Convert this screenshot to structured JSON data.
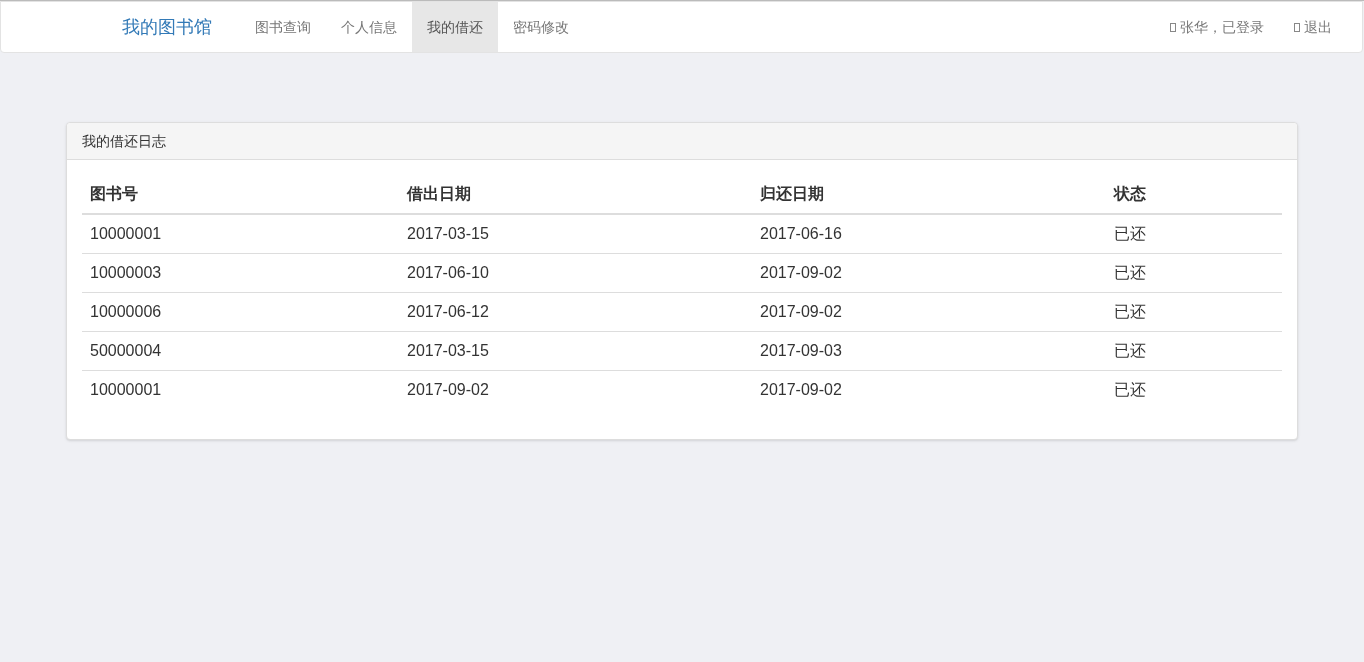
{
  "navbar": {
    "brand": "我的图书馆",
    "nav_items": [
      {
        "label": "图书查询",
        "selected": false
      },
      {
        "label": "个人信息",
        "selected": false
      },
      {
        "label": "我的借还",
        "selected": true
      },
      {
        "label": "密码修改",
        "selected": false
      }
    ],
    "right_items": [
      "张华，已登录",
      "退出"
    ]
  },
  "panel": {
    "title": "我的借还日志",
    "table": {
      "columns": [
        "图书号",
        "借出日期",
        "归还日期",
        "状态"
      ],
      "rows": [
        [
          "10000001",
          "2017-03-15",
          "2017-06-16",
          "已还"
        ],
        [
          "10000003",
          "2017-06-10",
          "2017-09-02",
          "已还"
        ],
        [
          "10000006",
          "2017-06-12",
          "2017-09-02",
          "已还"
        ],
        [
          "50000004",
          "2017-03-15",
          "2017-09-03",
          "已还"
        ],
        [
          "10000001",
          "2017-09-02",
          "2017-09-02",
          "已还"
        ]
      ]
    }
  }
}
